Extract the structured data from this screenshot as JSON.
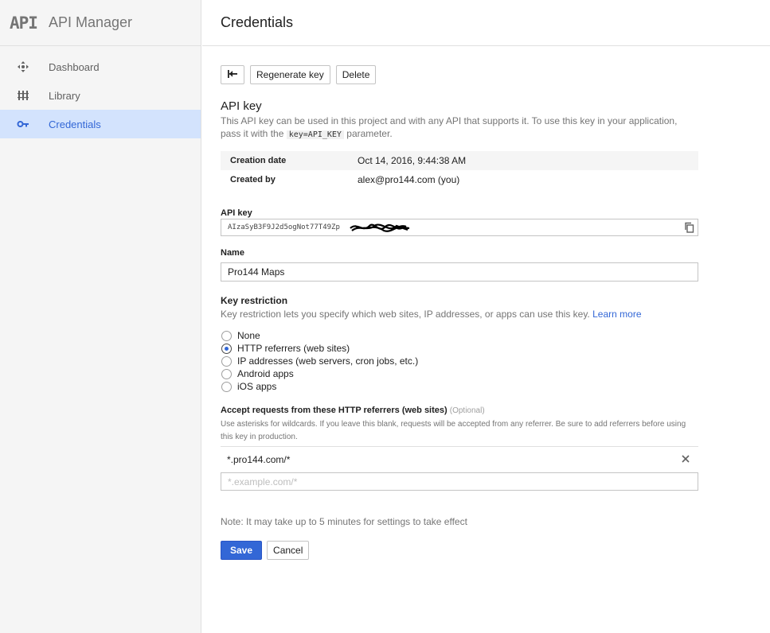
{
  "brand": {
    "logo_text": "API",
    "name": "API Manager"
  },
  "sidebar": {
    "items": [
      {
        "label": "Dashboard",
        "icon": "dashboard-icon",
        "active": false
      },
      {
        "label": "Library",
        "icon": "library-icon",
        "active": false
      },
      {
        "label": "Credentials",
        "icon": "key-icon",
        "active": true
      }
    ]
  },
  "header": {
    "title": "Credentials"
  },
  "toolbar": {
    "back_icon": "back-arrow-icon",
    "regenerate_label": "Regenerate key",
    "delete_label": "Delete"
  },
  "api_key_section": {
    "title": "API key",
    "description_before": "This API key can be used in this project and with any API that supports it. To use this key in your application, pass it with the ",
    "code": "key=API_KEY",
    "description_after": " parameter."
  },
  "info": {
    "creation_label": "Creation date",
    "creation_value": "Oct 14, 2016, 9:44:38 AM",
    "created_by_label": "Created by",
    "created_by_value": "alex@pro144.com (you)"
  },
  "api_key_field": {
    "label": "API key",
    "value": "AIzaSyB3F9J2d5ogNot77T49Zp",
    "copy_icon": "copy-icon"
  },
  "name_field": {
    "label": "Name",
    "value": "Pro144 Maps"
  },
  "key_restriction": {
    "title": "Key restriction",
    "description": "Key restriction lets you specify which web sites, IP addresses, or apps can use this key.",
    "learn_more": "Learn more",
    "options": [
      {
        "label": "None",
        "checked": false
      },
      {
        "label": "HTTP referrers (web sites)",
        "checked": true
      },
      {
        "label": "IP addresses (web servers, cron jobs, etc.)",
        "checked": false
      },
      {
        "label": "Android apps",
        "checked": false
      },
      {
        "label": "iOS apps",
        "checked": false
      }
    ]
  },
  "referrers": {
    "title": "Accept requests from these HTTP referrers (web sites)",
    "optional": "(Optional)",
    "description": "Use asterisks for wildcards. If you leave this blank, requests will be accepted from any referrer. Be sure to add referrers before using this key in production.",
    "entries": [
      "*.pro144.com/*"
    ],
    "input_placeholder": "*.example.com/*"
  },
  "note": "Note: It may take up to 5 minutes for settings to take effect",
  "actions": {
    "save_label": "Save",
    "cancel_label": "Cancel"
  },
  "colors": {
    "accent": "#3367d6",
    "active_bg": "#d3e3fd",
    "sidebar_bg": "#f5f5f5"
  }
}
